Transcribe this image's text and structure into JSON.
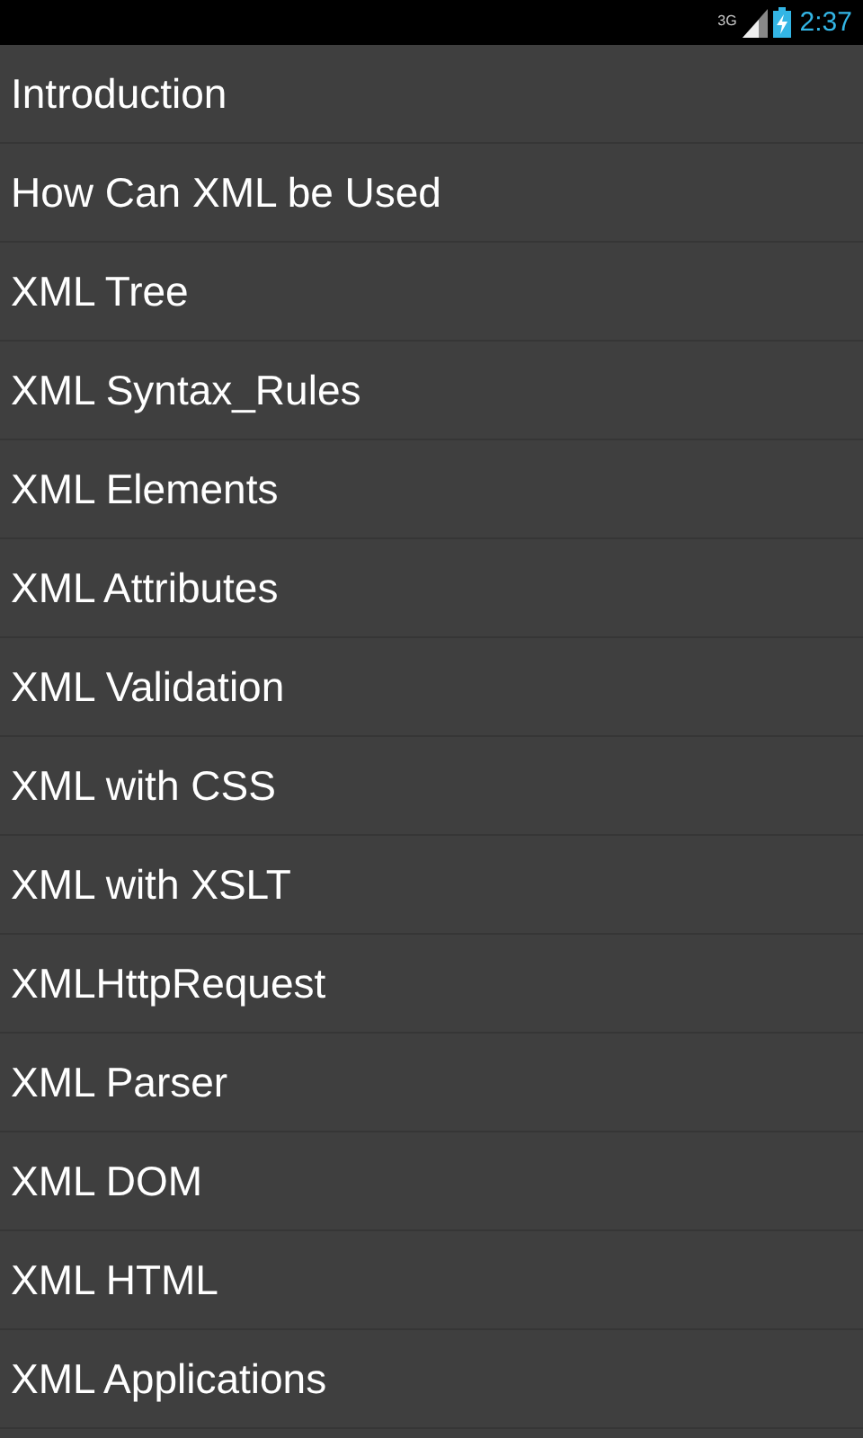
{
  "status_bar": {
    "network": "3G",
    "time": "2:37"
  },
  "items": [
    "Introduction",
    "How Can XML be Used",
    "XML Tree",
    "XML Syntax_Rules",
    "XML Elements",
    "XML Attributes",
    "XML Validation",
    "XML with CSS",
    "XML with XSLT",
    "XMLHttpRequest",
    "XML Parser",
    "XML DOM",
    "XML HTML",
    "XML Applications"
  ]
}
